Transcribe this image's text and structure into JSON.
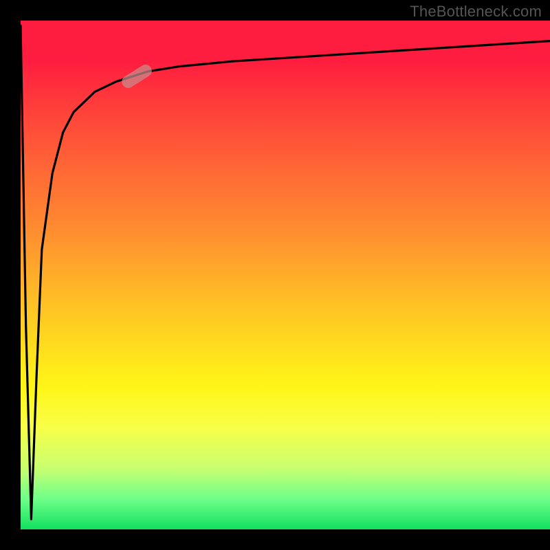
{
  "watermark": "TheBottleneck.com",
  "chart_data": {
    "type": "line",
    "title": "",
    "xlabel": "",
    "ylabel": "",
    "xlim": [
      0,
      100
    ],
    "ylim": [
      0,
      100
    ],
    "grid": false,
    "legend": false,
    "background_gradient": {
      "direction": "vertical",
      "stops": [
        {
          "pos": 0.0,
          "color": "#ff1d3f"
        },
        {
          "pos": 0.3,
          "color": "#ff6a35"
        },
        {
          "pos": 0.55,
          "color": "#ffc623"
        },
        {
          "pos": 0.78,
          "color": "#fcff2a"
        },
        {
          "pos": 0.94,
          "color": "#6fff8a"
        },
        {
          "pos": 1.0,
          "color": "#11e05e"
        }
      ]
    },
    "series": [
      {
        "name": "bottleneck-curve",
        "color": "#000000",
        "x": [
          0,
          1,
          2,
          3,
          4,
          6,
          8,
          10,
          14,
          18,
          24,
          30,
          40,
          55,
          70,
          85,
          100
        ],
        "values": [
          99,
          40,
          2,
          30,
          55,
          70,
          78,
          82,
          86,
          88,
          90,
          91,
          92,
          93,
          94,
          95,
          96
        ]
      }
    ],
    "marker": {
      "x": 22,
      "y": 89,
      "label": "highlight-pill",
      "color": "rgba(200,140,140,0.72)"
    }
  }
}
